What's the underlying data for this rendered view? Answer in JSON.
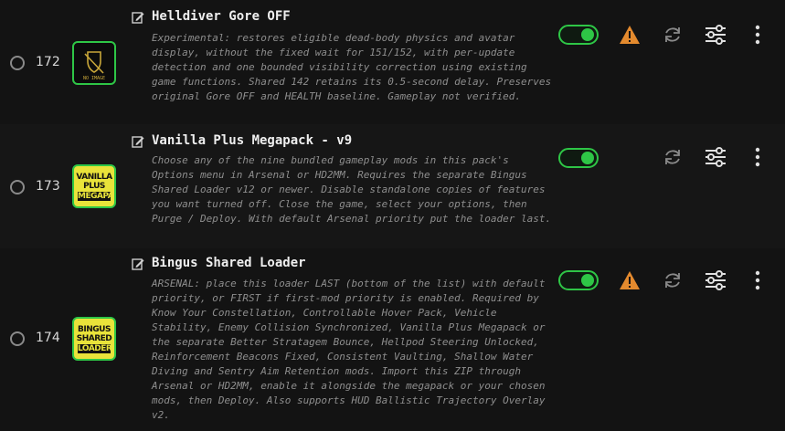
{
  "colors": {
    "accent": "#2ec646",
    "warning": "#e48a2e",
    "background": "#131313",
    "text": "#efefef",
    "muted": "#8e8e8e"
  },
  "mods": [
    {
      "index": "172",
      "title": "Helldiver Gore OFF",
      "thumbnail_text": "NO IMAGE",
      "enabled": true,
      "warning": true,
      "description": "Experimental: restores eligible dead-body physics and avatar display, without the fixed wait for 151/152, with per-update detection and one bounded visibility correction using existing game functions. Shared 142 retains its 0.5-second delay. Preserves original Gore OFF and HEALTH baseline. Gameplay not verified."
    },
    {
      "index": "173",
      "title": "Vanilla Plus Megapack - v9",
      "thumbnail_text": "VANILLA PLUS",
      "thumbnail_sub": "MEGAPACK",
      "enabled": true,
      "warning": false,
      "description": "Choose any of the nine bundled gameplay mods in this pack's Options menu in Arsenal or HD2MM. Requires the separate Bingus Shared Loader v12 or newer. Disable standalone copies of features you want turned off. Close the game, select your options, then Purge / Deploy. With default Arsenal priority put the loader last."
    },
    {
      "index": "174",
      "title": "Bingus Shared Loader",
      "thumbnail_text": "BINGUS SHARED",
      "thumbnail_sub": "LOADER",
      "enabled": true,
      "warning": true,
      "description": "ARSENAL: place this loader LAST (bottom of the list) with default priority, or FIRST if first-mod priority is enabled. Required by Know Your Constellation, Controllable Hover Pack, Vehicle Stability, Enemy Collision Synchronized, Vanilla Plus Megapack or the separate Better Stratagem Bounce, Hellpod Steering Unlocked, Reinforcement Beacons Fixed, Consistent Vaulting, Shallow Water Diving and Sentry Aim Retention mods. Import this ZIP through Arsenal or HD2MM, enable it alongside the megapack or your chosen mods, then Deploy. Also supports HUD Ballistic Trajectory Overlay v2."
    }
  ]
}
